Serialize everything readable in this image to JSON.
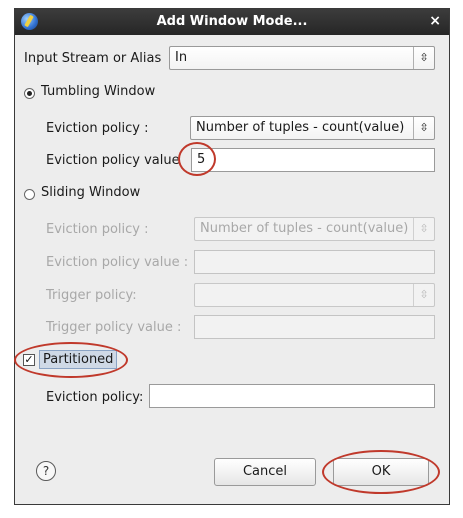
{
  "window": {
    "title": "Add Window Mode...",
    "close_glyph": "×"
  },
  "input_stream": {
    "label": "Input Stream or Alias",
    "value": "In"
  },
  "tumbling": {
    "label": "Tumbling Window",
    "selected": true,
    "eviction_label": "Eviction policy :",
    "eviction_value": "Number of tuples - count(value)",
    "eviction_value_label": "Eviction policy value",
    "eviction_value_value": "5"
  },
  "sliding": {
    "label": "Sliding Window",
    "selected": false,
    "eviction_label": "Eviction policy :",
    "eviction_value": "Number of tuples - count(value)",
    "eviction_value_label": "Eviction policy value :",
    "eviction_value_value": "",
    "trigger_label": "Trigger policy:",
    "trigger_value": "",
    "trigger_value_label": "Trigger policy value  :",
    "trigger_value_value": ""
  },
  "partitioned": {
    "label": "Partitioned",
    "checked": true,
    "check_glyph": "✓",
    "eviction_label": "Eviction policy:",
    "eviction_value": ""
  },
  "buttons": {
    "cancel": "Cancel",
    "ok": "OK",
    "help": "?"
  },
  "icons": {
    "combo_arrows": "⇳"
  },
  "colors": {
    "annotation": "#c0392b",
    "titlebar": "#2e2e2e"
  }
}
